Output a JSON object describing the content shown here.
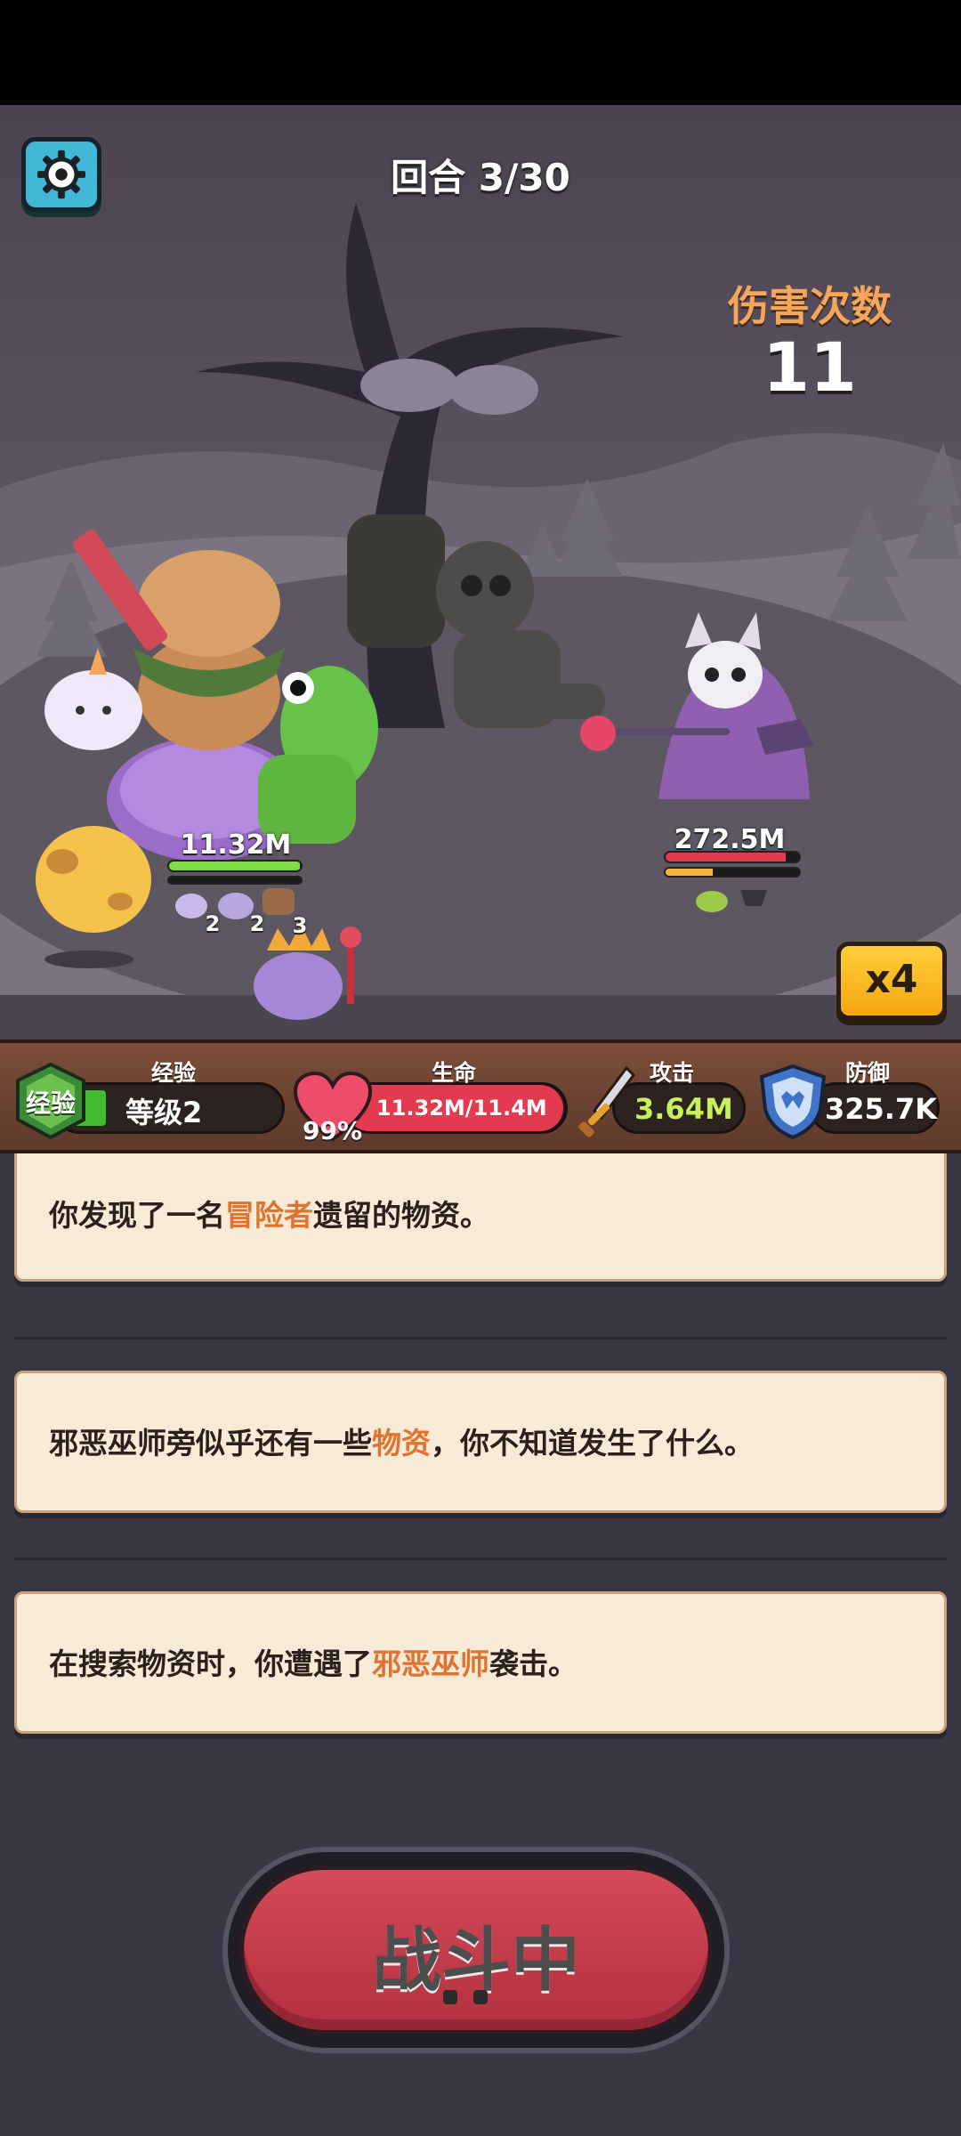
{
  "hud": {
    "round_text": "回合 3/30",
    "damage_count_label": "伤害次数",
    "damage_count_value": "11",
    "speed_button_label": "x4"
  },
  "battle": {
    "player_hp_label": "11.32M",
    "enemy_hp_label": "272.5M",
    "player_hp_fraction": 0.99,
    "enemy_hp_fraction": 0.9,
    "enemy_energy_fraction": 0.35,
    "pet_counts": [
      "2",
      "2",
      "3"
    ]
  },
  "stats": {
    "exp_label": "经验",
    "exp_badge": "经验",
    "level_text": "等级2",
    "exp_fraction": 0.15,
    "hp_label": "生命",
    "hp_percent": "99%",
    "hp_text": "11.32M/11.4M",
    "attack_label": "攻击",
    "attack_value": "3.64M",
    "defense_label": "防御",
    "defense_value": "325.7K"
  },
  "log": [
    {
      "before": "你发现了一名",
      "highlight": "冒险者",
      "after": "遗留的物资。"
    },
    {
      "before": "邪恶巫师旁似乎还有一些",
      "highlight": "物资",
      "after": "，你不知道发生了什么。"
    },
    {
      "before": "在搜索物资时，你遭遇了",
      "highlight": "邪恶巫师",
      "after": "袭击。"
    }
  ],
  "fight_button_label": "战斗中",
  "colors": {
    "highlight": "#e0732f",
    "damage_label": "#f5a65a",
    "fight_button": "#c23a4a",
    "speed_button": "#f7b51f",
    "hp_bar": "#e23a4e",
    "exp_bar": "#3fbd2e"
  }
}
